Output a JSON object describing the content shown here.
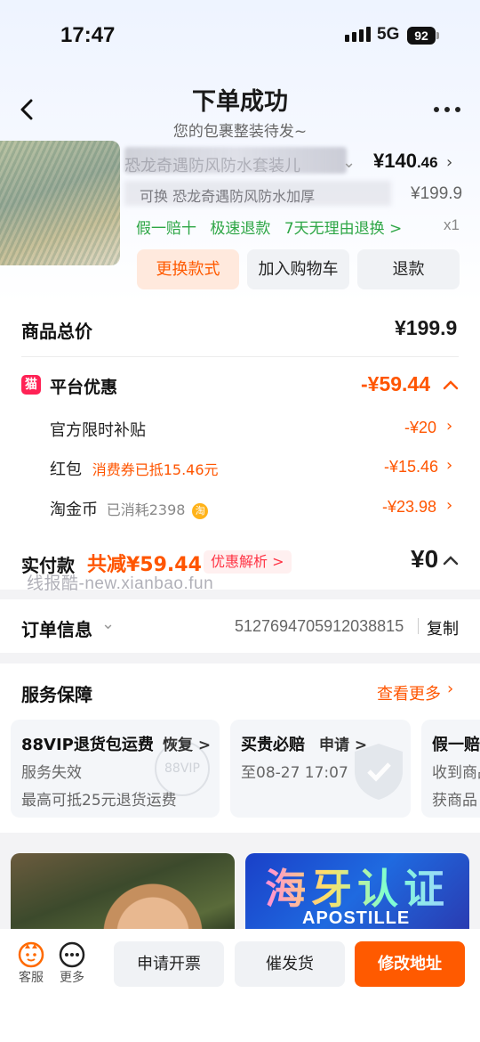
{
  "status_bar": {
    "time": "17:47",
    "network": "5G",
    "battery": "92"
  },
  "nav": {
    "title": "下单成功",
    "subtitle": "您的包裹整装待发~"
  },
  "product": {
    "name": "恐龙奇遇防风防水套装儿",
    "price_int": "¥140",
    "price_dec": ".46",
    "sku": "可换 恐龙奇遇防风防水加厚",
    "original_price": "¥199.9",
    "guarantees": [
      "假一赔十",
      "极速退款",
      "7天无理由退换 >"
    ],
    "quantity": "x1"
  },
  "actions": {
    "change_style": "更换款式",
    "add_to_cart": "加入购物车",
    "refund": "退款"
  },
  "pricing": {
    "total_label": "商品总价",
    "total_value": "¥199.9",
    "platform_discount_label": "平台优惠",
    "platform_discount_value": "-¥59.44",
    "items": [
      {
        "label": "官方限时补贴",
        "note": "",
        "value": "-¥20"
      },
      {
        "label": "红包",
        "note": "消费券已抵15.46元",
        "value": "-¥15.46"
      },
      {
        "label": "淘金币",
        "note": "已消耗2398",
        "value": "-¥23.98"
      }
    ],
    "paid_label": "实付款",
    "saved_text": "共减¥59.44",
    "analysis_tag": "优惠解析 >",
    "paid_value": "¥0"
  },
  "watermark": "线报酷-new.xianbao.fun",
  "order": {
    "label": "订单信息",
    "number": "5127694705912038815",
    "copy": "复制"
  },
  "service": {
    "title": "服务保障",
    "more": "查看更多",
    "cards": [
      {
        "title": "88VIP退货包运费",
        "action": "恢复 >",
        "line1": "服务失效",
        "line2": "最高可抵25元退货运费",
        "mark": "88VIP"
      },
      {
        "title": "买贵必赔",
        "action": "申请 >",
        "line1": "至08-27 17:07",
        "line2": "",
        "mark": ""
      },
      {
        "title": "假一赔",
        "action": "",
        "line1": "收到商品",
        "line2": "获商品",
        "mark": ""
      }
    ]
  },
  "banner": {
    "right_big": "海牙认证",
    "right_small": "APOSTILLE"
  },
  "bottom_bar": {
    "service_label": "客服",
    "more_label": "更多",
    "invoice": "申请开票",
    "urge": "催发货",
    "modify_address": "修改地址"
  },
  "colors": {
    "accent": "#ff5a00",
    "green": "#2da645",
    "price_red": "#ff5500"
  }
}
